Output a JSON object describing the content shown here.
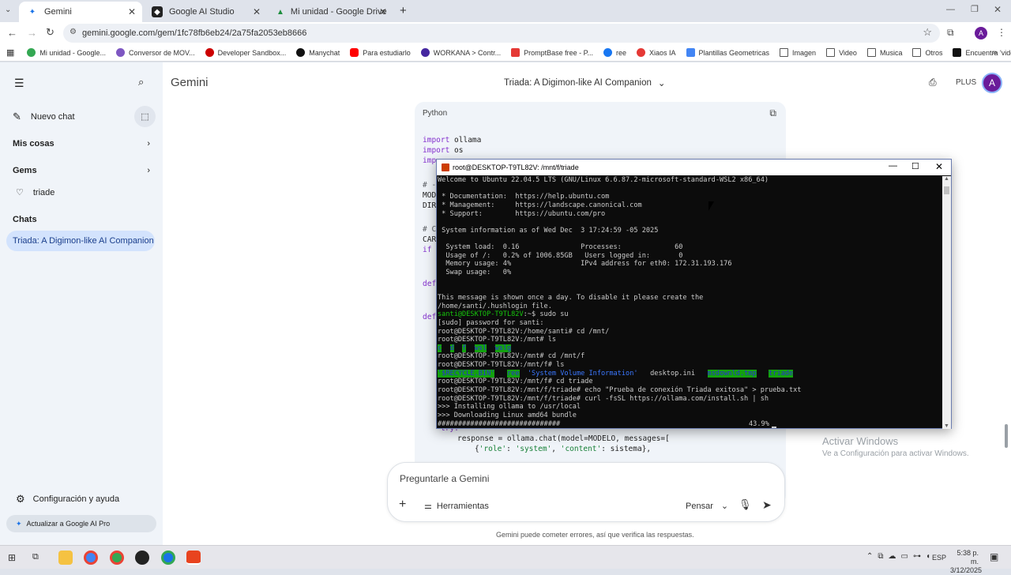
{
  "browser": {
    "tabs": [
      {
        "label": "Gemini",
        "active": true
      },
      {
        "label": "Google AI Studio",
        "active": false
      },
      {
        "label": "Mi unidad - Google Drive",
        "active": false
      }
    ],
    "url": "gemini.google.com/gem/1fc78fb6eb24/2a75fa2053eb8666",
    "bookmarks": [
      "Mi unidad - Google...",
      "Conversor de MOV...",
      "Developer Sandbox...",
      "Manychat",
      "Para estudiarlo",
      "WORKANA > Contr...",
      "PromptBase free - P...",
      "ree",
      "Xiaos IA",
      "Plantillas Geometricas",
      "Imagen",
      "Video",
      "Musica",
      "Otros",
      "Encuentra 'videos te..."
    ],
    "profile_initial": "A"
  },
  "sidebar": {
    "app_name": "Gemini",
    "new_chat": "Nuevo chat",
    "my_stuff": "Mis cosas",
    "gems": "Gems",
    "gem_item": "triade",
    "chats": "Chats",
    "active_chat": "Triada: A Digimon-like AI Companion",
    "settings": "Configuración y ayuda",
    "upgrade": "Actualizar a Google AI Pro"
  },
  "header": {
    "title": "Triada: A Digimon-like AI Companion",
    "plan": "PLUS",
    "avatar": "A"
  },
  "code": {
    "language": "Python",
    "lines_top": [
      "import ollama",
      "import os",
      "imp"
    ],
    "lines_left": [
      "# -",
      "MODE",
      "DIRE",
      "",
      "# C",
      "CARG",
      "if c",
      "",
      "",
      "def",
      "",
      "",
      "def"
    ],
    "lines_bottom": [
      "try:",
      "    response = ollama.chat(model=MODELO, messages=[",
      "        {'role': 'system', 'content': sistema},"
    ]
  },
  "input": {
    "placeholder": "Preguntarle a Gemini",
    "tools": "Herramientas",
    "mode": "Pensar",
    "disclaimer": "Gemini puede cometer errores, así que verifica las respuestas."
  },
  "terminal": {
    "title": "root@DESKTOP-T9TL82V: /mnt/f/triade",
    "lines": [
      "Welcome to Ubuntu 22.04.5 LTS (GNU/Linux 6.6.87.2-microsoft-standard-WSL2 x86_64)",
      "",
      " * Documentation:  https://help.ubuntu.com",
      " * Management:     https://landscape.canonical.com",
      " * Support:        https://ubuntu.com/pro",
      "",
      " System information as of Wed Dec  3 17:24:59 -05 2025",
      "",
      "  System load:  0.16               Processes:             60",
      "  Usage of /:   0.2% of 1006.85GB   Users logged in:       0",
      "  Memory usage: 4%                 IPv4 address for eth0: 172.31.193.176",
      "  Swap usage:   0%",
      "",
      "",
      "This message is shown once a day. To disable it please create the",
      "/home/santi/.hushlogin file."
    ],
    "prompt_user": "santi@DESKTOP-T9TL82V",
    "prompt_user_tail": ":~$ sudo su",
    "l_sudo": "[sudo] password for santi:",
    "l_cd_mnt": "root@DESKTOP-T9TL82V:/home/santi# cd /mnt/",
    "l_ls1": "root@DESKTOP-T9TL82V:/mnt# ls",
    "ls1_items": [
      "c",
      "d",
      "f",
      "wsl",
      "wslg"
    ],
    "l_cd_f": "root@DESKTOP-T9TL82V:/mnt# cd /mnt/f",
    "l_ls2": "root@DESKTOP-T9TL82V:/mnt/f# ls",
    "ls2_items": [
      "'$RECYCLE.BIN'",
      "ree",
      "'System Volume Information'",
      "desktop.ini",
      "msdownld.tmp",
      "triade"
    ],
    "l_cd_triade": "root@DESKTOP-T9TL82V:/mnt/f# cd triade",
    "l_echo": "root@DESKTOP-T9TL82V:/mnt/f/triade# echo \"Prueba de conexión Triada exitosa\" > prueba.txt",
    "l_curl": "root@DESKTOP-T9TL82V:/mnt/f/triade# curl -fsSL https://ollama.com/install.sh | sh",
    "l_install": ">>> Installing ollama to /usr/local",
    "l_download": ">>> Downloading Linux amd64 bundle",
    "progress_bar": "##############################",
    "progress_pct": "43.9%"
  },
  "watermark": {
    "title": "Activar Windows",
    "subtitle": "Ve a Configuración para activar Windows."
  },
  "taskbar": {
    "time": "5:38 p. m.",
    "date": "3/12/2025",
    "lang": "ESP"
  },
  "colors": {
    "accent": "#1a73e8",
    "terminal_bg": "#0c0c0c",
    "terminal_green": "#16c60c",
    "highlight_green": "#13a10e"
  }
}
